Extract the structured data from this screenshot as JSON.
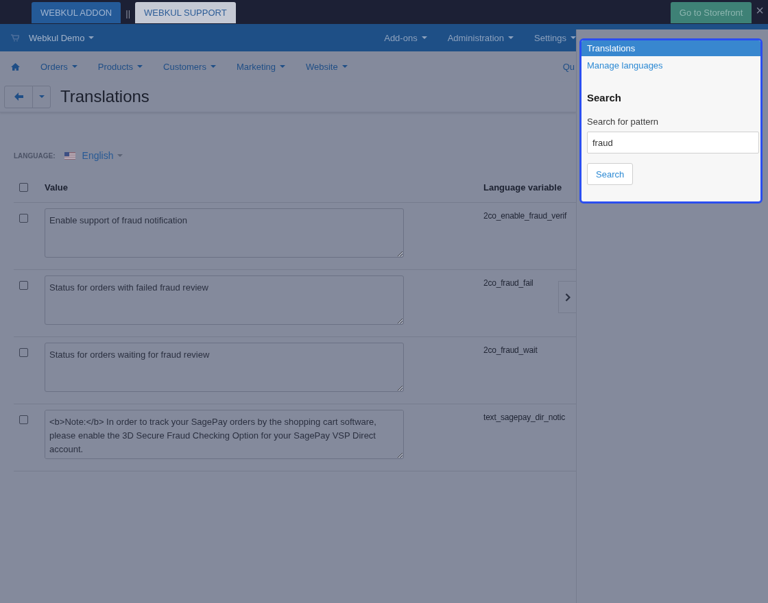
{
  "top_bar": {
    "tabs": [
      {
        "label": "WEBKUL ADDON",
        "selected": true
      },
      {
        "label": "WEBKUL SUPPORT",
        "selected": false
      }
    ],
    "separator": "||",
    "storefront_button": "Go to Storefront",
    "close": "×"
  },
  "header": {
    "store": "Webkul Demo",
    "menu": [
      "Add-ons",
      "Administration",
      "Settings"
    ]
  },
  "nav": {
    "items": [
      "Orders",
      "Products",
      "Customers",
      "Marketing",
      "Website"
    ],
    "cut_item": "Qu"
  },
  "page": {
    "title": "Translations",
    "language_label": "LANGUAGE:",
    "language": "English"
  },
  "table": {
    "columns": [
      "Value",
      "Language variable"
    ],
    "select_all_checked": false,
    "rows": [
      {
        "checked": false,
        "value": "Enable support of fraud notification",
        "variable": "2co_enable_fraud_verif"
      },
      {
        "checked": false,
        "value": "Status for orders with failed fraud review",
        "variable": "2co_fraud_fail"
      },
      {
        "checked": false,
        "value": "Status for orders waiting for fraud review",
        "variable": "2co_fraud_wait"
      },
      {
        "checked": false,
        "value": "<b>Note:</b> In order to track your SagePay orders by the shopping cart software, please enable the 3D Secure Fraud Checking Option for your SagePay VSP Direct account.",
        "variable": "text_sagepay_dir_notic"
      }
    ]
  },
  "sidebar": {
    "header": "Translations",
    "link": "Manage languages",
    "search_heading": "Search",
    "field_label": "Search for pattern",
    "field_value": "fraud",
    "button": "Search"
  }
}
